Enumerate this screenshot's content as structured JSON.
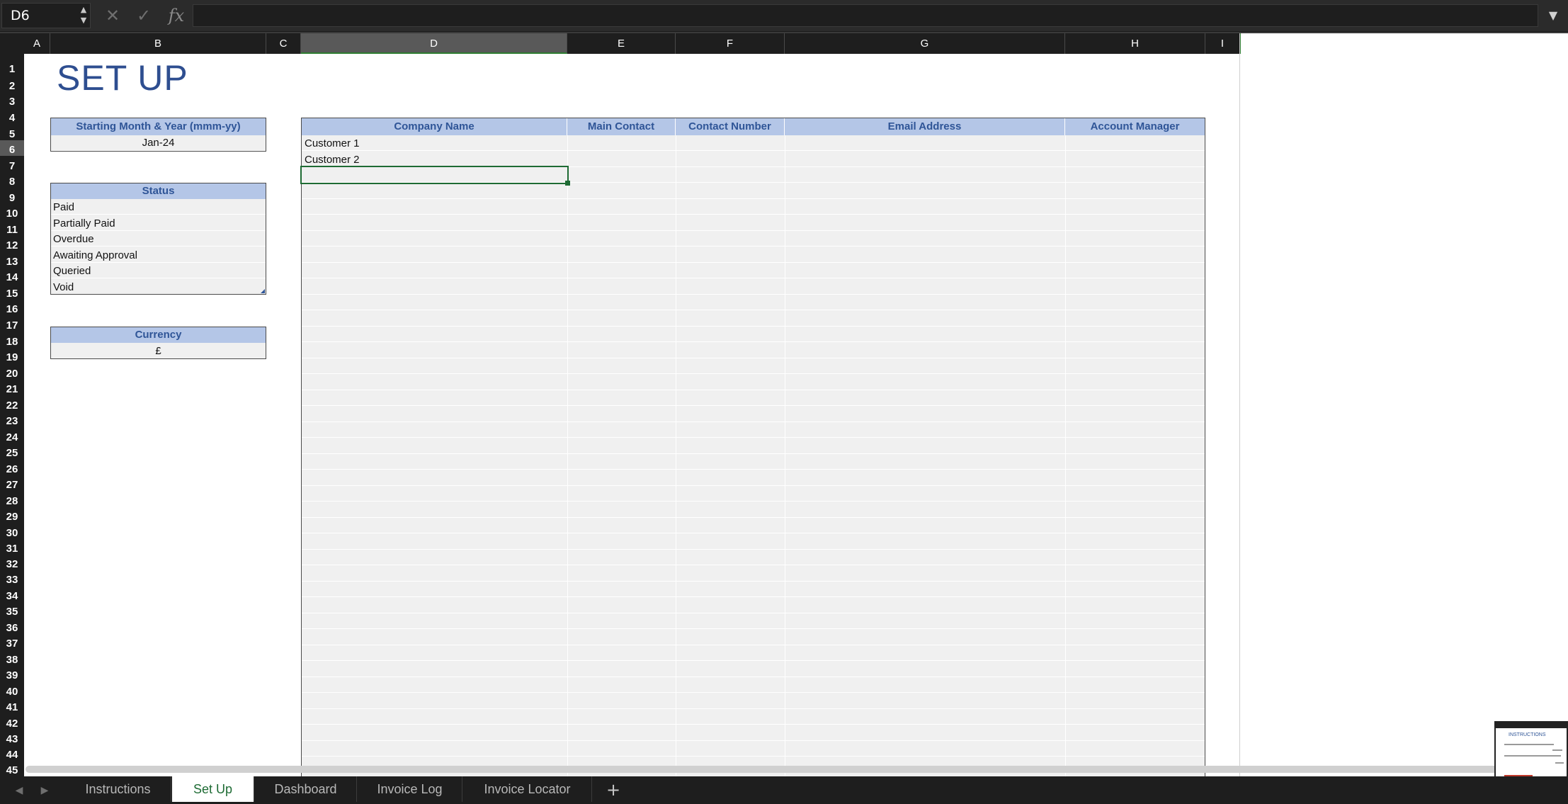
{
  "formula_bar": {
    "name_box": "D6",
    "cancel_icon": "✕",
    "confirm_icon": "✓",
    "fx_icon": "fx",
    "stepper_up": "▲",
    "stepper_down": "▼",
    "dropdown_icon": "▼",
    "formula": ""
  },
  "column_headers": [
    "A",
    "B",
    "C",
    "D",
    "E",
    "F",
    "G",
    "H",
    "I"
  ],
  "selected_column": "D",
  "row_headers": [
    "1",
    "2",
    "3",
    "4",
    "5",
    "6",
    "7",
    "8",
    "9",
    "10",
    "11",
    "12",
    "13",
    "14",
    "15",
    "16",
    "17",
    "18",
    "19",
    "20",
    "21",
    "22",
    "23",
    "24",
    "25",
    "26",
    "27",
    "28",
    "29",
    "30",
    "31",
    "32",
    "33",
    "34",
    "35",
    "36",
    "37",
    "38",
    "39",
    "40",
    "41",
    "42",
    "43",
    "44",
    "45"
  ],
  "selected_row": "6",
  "sheet": {
    "title": "SET UP",
    "start_panel": {
      "header": "Starting Month & Year (mmm-yy)",
      "value": "Jan-24"
    },
    "status_panel": {
      "header": "Status",
      "items": [
        "Paid",
        "Partially Paid",
        "Overdue",
        "Awaiting Approval",
        "Queried",
        "Void"
      ]
    },
    "currency_panel": {
      "header": "Currency",
      "value": "£"
    },
    "customers_table": {
      "headers": [
        "Company Name",
        "Main Contact",
        "Contact Number",
        "Email Address",
        "Account Manager"
      ],
      "rows": [
        [
          "Customer 1",
          "",
          "",
          "",
          ""
        ],
        [
          "Customer 2",
          "",
          "",
          "",
          ""
        ]
      ]
    }
  },
  "tabs": {
    "items": [
      "Instructions",
      "Set Up",
      "Dashboard",
      "Invoice Log",
      "Invoice Locator"
    ],
    "active": "Set Up",
    "add_icon": "+",
    "prev_icon": "◀",
    "next_icon": "▶"
  },
  "thumbnail": {
    "title": "INSTRUCTIONS"
  },
  "colors": {
    "header_fill": "#b4c6e7",
    "header_text": "#2f5597",
    "title_text": "#2e4e90",
    "active_tab_text": "#1e6b34",
    "cell_fill": "#f0f0f0",
    "selection": "#1e6b34"
  }
}
